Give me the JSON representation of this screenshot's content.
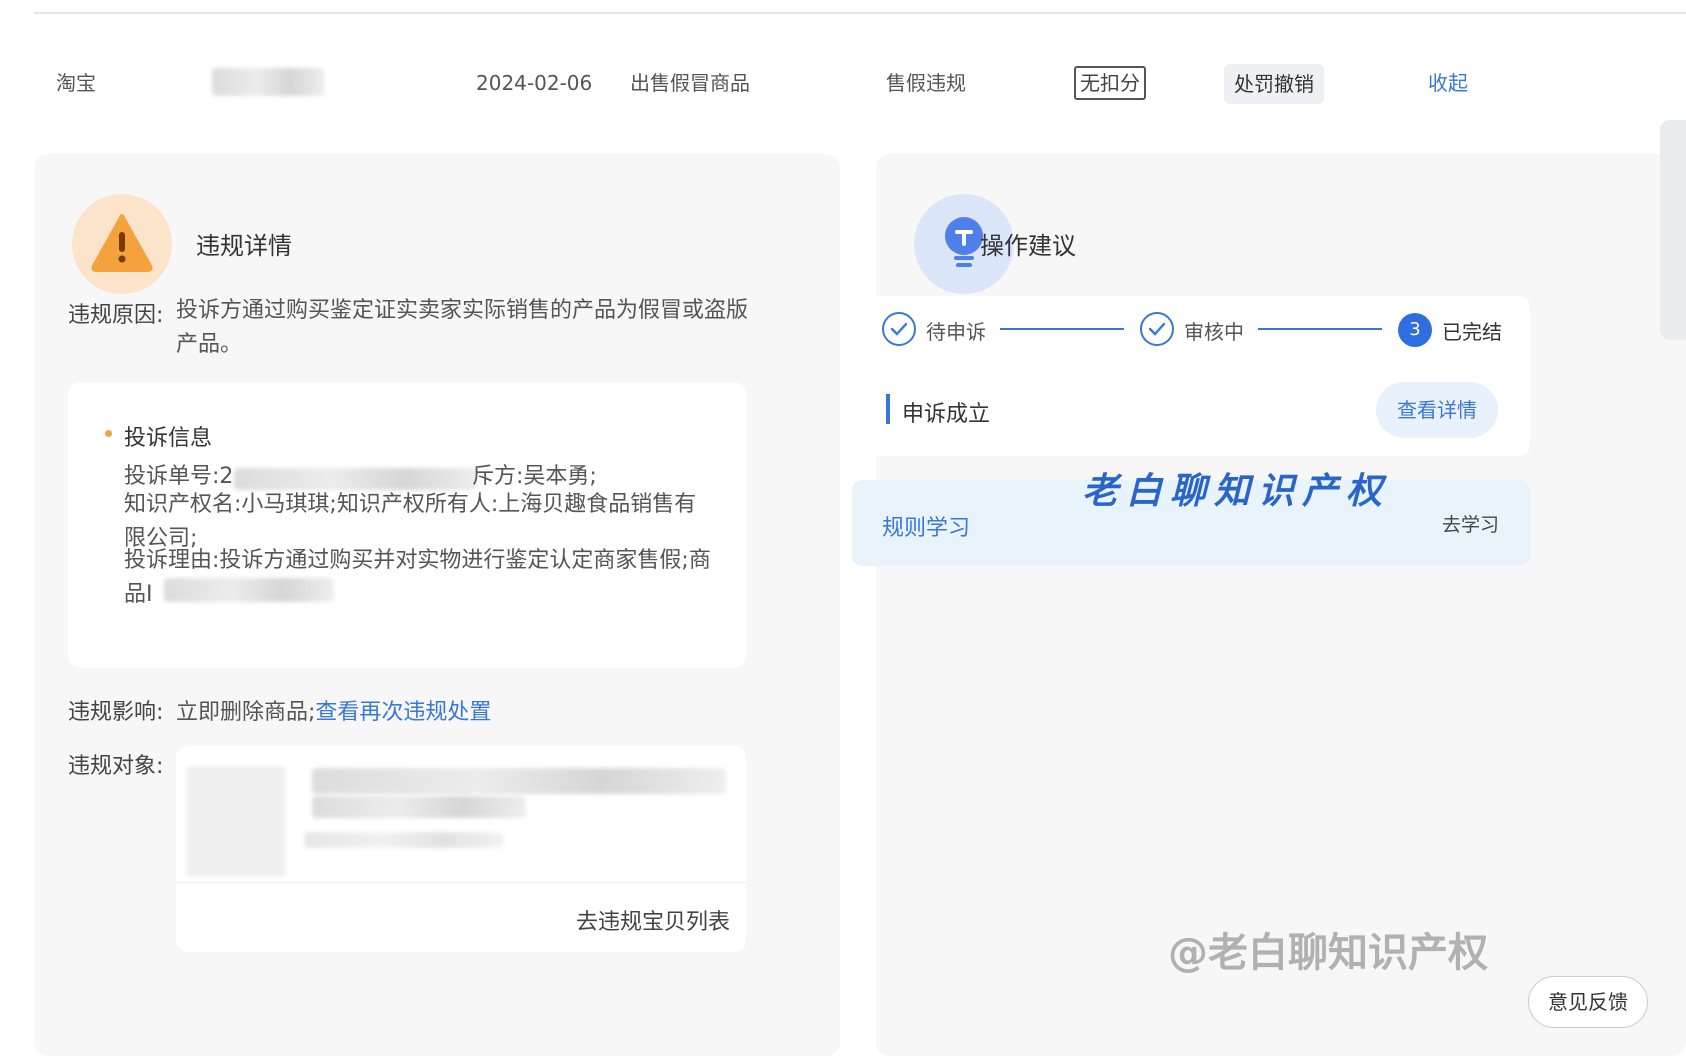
{
  "header_row": {
    "platform": "淘宝",
    "date": "2024-02-06",
    "violation_name": "出售假冒商品",
    "violation_type": "售假违规",
    "deduction_tag": "无扣分",
    "status_tag": "处罚撤销",
    "collapse_link": "收起"
  },
  "left_panel": {
    "title": "违规详情",
    "reason_label": "违规原因:",
    "reason_text": "投诉方通过购买鉴定证实卖家实际销售的产品为假冒或盗版产品。",
    "complaint_card": {
      "heading": "投诉信息",
      "line1_prefix": "投诉单号:2",
      "line1_suffix": "斥方:吴本勇;",
      "line2": "知识产权名:小马琪琪;知识产权所有人:上海贝趣食品销售有限公司;",
      "line3": "投诉理由:投诉方通过购买并对实物进行鉴定认定商家售假;商品I",
      "line3_tail": "D"
    },
    "impact_label": "违规影响:",
    "impact_text": "立即删除商品;",
    "impact_link": "查看再次违规处置",
    "object_label": "违规对象:",
    "object_link": "去违规宝贝列表"
  },
  "right_panel": {
    "title": "操作建议",
    "steps": [
      {
        "label": "待申诉",
        "state": "done"
      },
      {
        "label": "审核中",
        "state": "done"
      },
      {
        "label": "已完结",
        "state": "current",
        "num": "3"
      }
    ],
    "result_text": "申诉成立",
    "detail_button": "查看详情",
    "rule_study": "规则学习",
    "go_study": "去学习"
  },
  "watermark_text": "老白聊知识产权",
  "weibo_watermark": "@老白聊知识产权",
  "feedback_button": "意见反馈",
  "colors": {
    "accent_blue": "#3a78d6",
    "warning_orange": "#f0a24a",
    "panel_bg": "#f7f7f7",
    "study_bg": "#e8f3fb"
  }
}
